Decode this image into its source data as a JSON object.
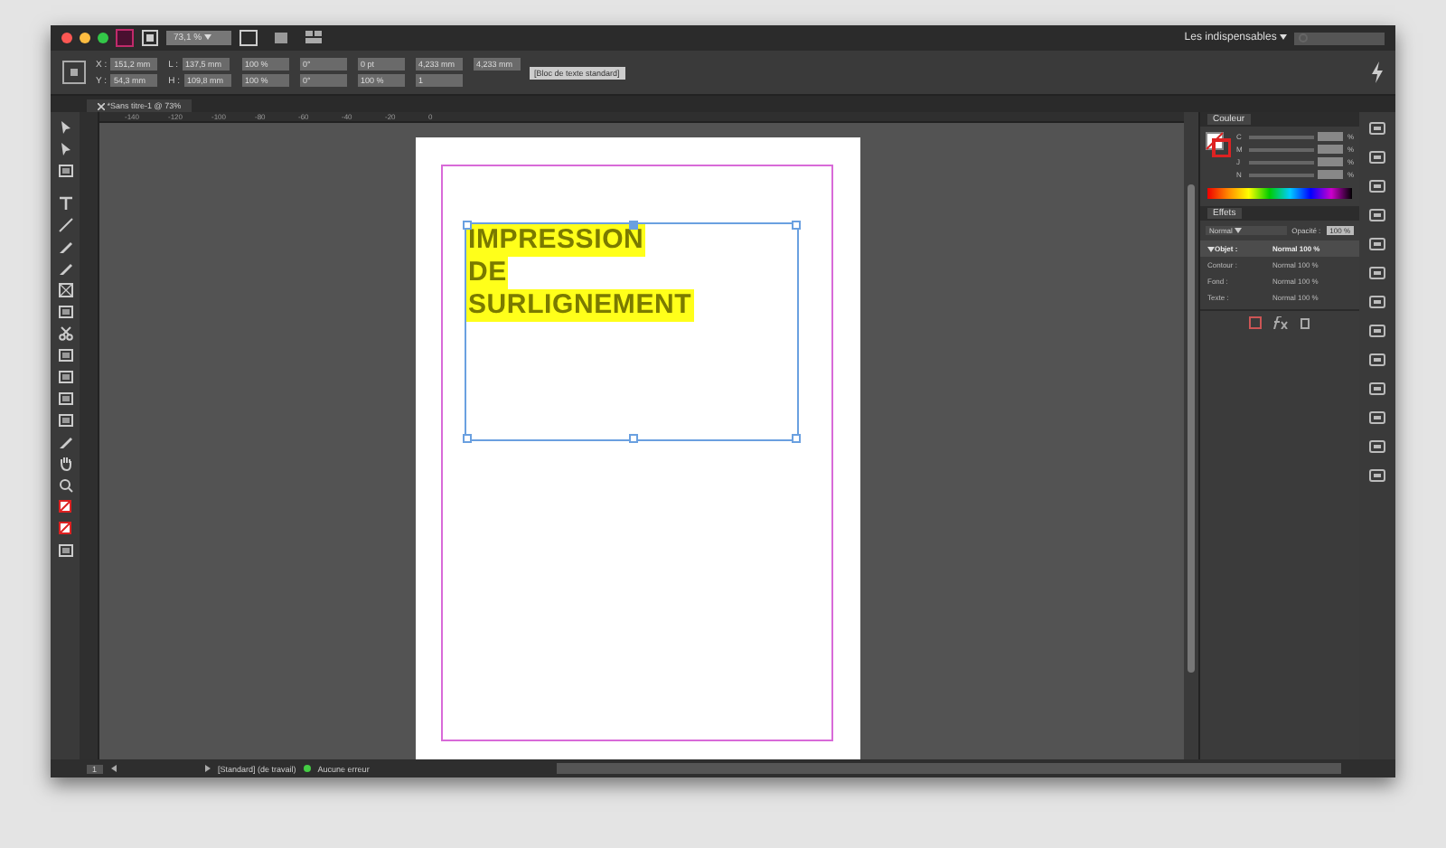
{
  "window": {
    "zoom": "73,1 %",
    "workspace": "Les indispensables"
  },
  "control_panel": {
    "fields": [
      {
        "label": "X :",
        "value": "151,2 mm"
      },
      {
        "label": "Y :",
        "value": "54,3 mm"
      },
      {
        "label": "L :",
        "value": "137,5 mm"
      },
      {
        "label": "H :",
        "value": "109,8 mm"
      },
      {
        "value": "100 %"
      },
      {
        "value": "100 %"
      },
      {
        "value": "0°"
      },
      {
        "value": "0°"
      },
      {
        "value": "0 pt"
      },
      {
        "value": "100 %"
      },
      {
        "value": "4,233 mm"
      },
      {
        "value": "1"
      },
      {
        "value": "4,233 mm"
      }
    ],
    "style": "[Bloc de texte standard]"
  },
  "document_tab": {
    "title": "*Sans titre-1 @ 73%"
  },
  "ruler": {
    "marks": [
      "-140",
      "-120",
      "-100",
      "-80",
      "-60",
      "-40",
      "-20",
      "0"
    ]
  },
  "document": {
    "lines": [
      "IMPRESSION",
      "DE",
      "SURLIGNEMENT"
    ]
  },
  "color_panel": {
    "title": "Couleur",
    "channels": [
      {
        "name": "C",
        "unit": "%",
        "level": 0
      },
      {
        "name": "M",
        "unit": "%",
        "level": 0
      },
      {
        "name": "J",
        "unit": "%",
        "level": 0
      },
      {
        "name": "N",
        "unit": "%",
        "level": 0
      }
    ]
  },
  "effects_panel": {
    "title": "Effets",
    "blend": "Normal",
    "opacity_label": "Opacité :",
    "opacity": "100 %",
    "rows": [
      {
        "name": "Objet :",
        "value": "Normal 100 %",
        "expanded": true,
        "selected": true
      },
      {
        "name": "Contour :",
        "value": "Normal 100 %",
        "selected": false
      },
      {
        "name": "Fond :",
        "value": "Normal 100 %",
        "selected": false
      },
      {
        "name": "Texte :",
        "value": "Normal 100 %",
        "selected": false
      }
    ]
  },
  "status_bar": {
    "page": "1",
    "style": "[Standard] (de travail)",
    "preflight": "Aucune erreur"
  }
}
